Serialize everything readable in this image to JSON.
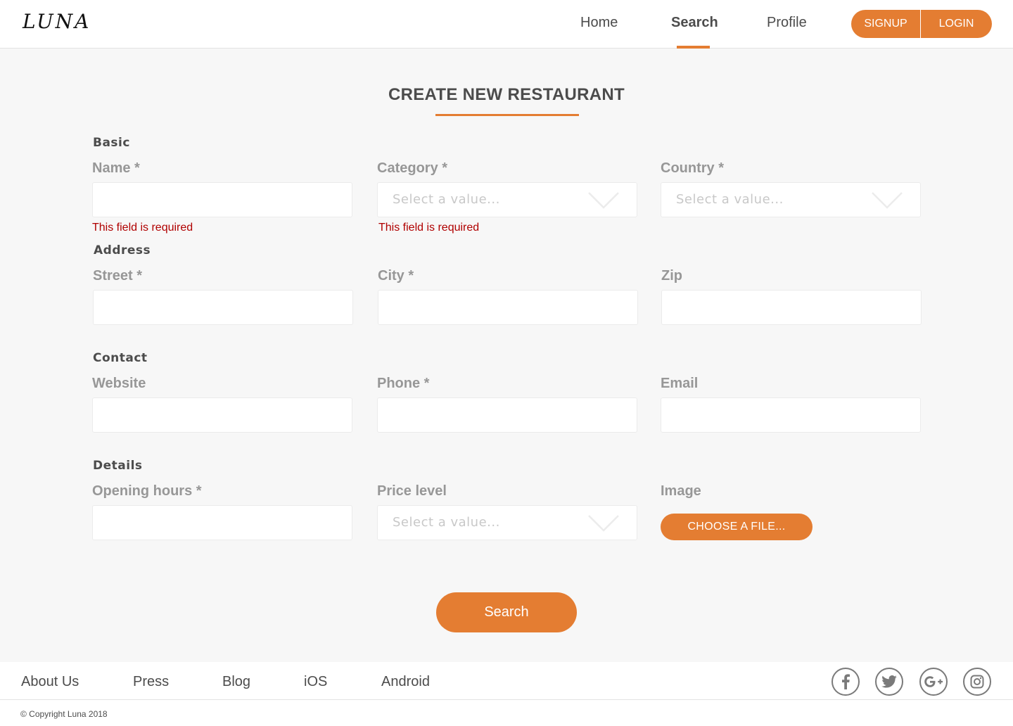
{
  "header": {
    "logo": "LUNA",
    "nav": {
      "home": "Home",
      "search": "Search",
      "profile": "Profile"
    },
    "signup_label": "SIGNUP",
    "login_label": "LOGIN"
  },
  "page": {
    "title": "CREATE NEW RESTAURANT"
  },
  "form": {
    "sections": {
      "basic": "Basic",
      "address": "Address",
      "contact": "Contact",
      "details": "Details"
    },
    "labels": {
      "name": "Name *",
      "category": "Category *",
      "country": "Country *",
      "street": "Street *",
      "city": "City *",
      "zip": "Zip",
      "website": "Website",
      "phone": "Phone *",
      "email": "Email",
      "opening_hours": "Opening hours *",
      "price_level": "Price level",
      "image": "Image"
    },
    "select_placeholder": "Select a value...",
    "errors": {
      "name": "This field is required",
      "category": "This field is required"
    },
    "file_button": "CHOOSE A FILE...",
    "submit_label": "Search"
  },
  "footer": {
    "links": [
      "About Us",
      "Press",
      "Blog",
      "iOS",
      "Android"
    ],
    "social_icons": [
      "facebook-icon",
      "twitter-icon",
      "google-plus-icon",
      "instagram-icon"
    ],
    "copyright": "© Copyright Luna 2018"
  },
  "colors": {
    "accent": "#e47d32",
    "error": "#b00000",
    "background": "#f7f7f7"
  }
}
